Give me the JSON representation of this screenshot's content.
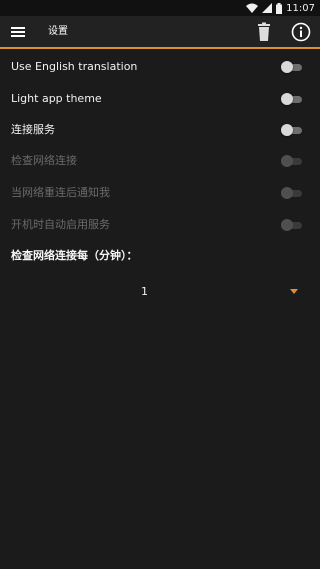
{
  "status_bar": {
    "time": "11:07",
    "icons": [
      "wifi-icon",
      "signal-icon",
      "battery-icon"
    ]
  },
  "toolbar": {
    "title": "设置",
    "menu_icon": "hamburger-menu-icon",
    "delete_icon": "trash-icon",
    "info_icon": "info-icon",
    "accent_color": "#e0902e"
  },
  "settings": [
    {
      "label": "Use English translation",
      "checked": false,
      "enabled": true
    },
    {
      "label": "Light app theme",
      "checked": false,
      "enabled": true
    },
    {
      "label": "连接服务",
      "checked": false,
      "enabled": true
    },
    {
      "label": "检查网络连接",
      "checked": false,
      "enabled": false
    },
    {
      "label": "当网络重连后通知我",
      "checked": false,
      "enabled": false
    },
    {
      "label": "开机时自动启用服务",
      "checked": false,
      "enabled": false
    }
  ],
  "interval": {
    "label": "检查网络连接每（分钟）：",
    "selected_value": "1"
  }
}
